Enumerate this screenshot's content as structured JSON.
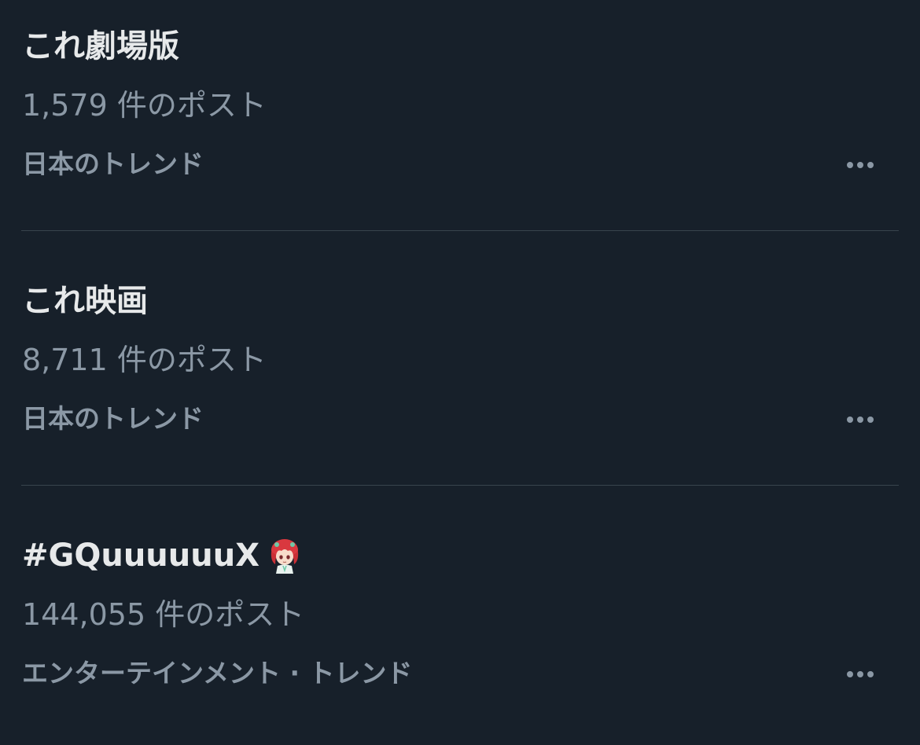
{
  "trends": [
    {
      "title": "これ劇場版",
      "count": "1,579 件のポスト",
      "context": "日本のトレンド",
      "more_icon": "more-horizontal-icon"
    },
    {
      "title": "これ映画",
      "count": "8,711 件のポスト",
      "context": "日本のトレンド",
      "more_icon": "more-horizontal-icon"
    },
    {
      "title": "#GQuuuuuuX",
      "title_emoji": "character-avatar-emoji",
      "count": "144,055 件のポスト",
      "context": "エンターテインメント · トレンド",
      "more_icon": "more-horizontal-icon"
    }
  ],
  "colors": {
    "background": "#17202a",
    "title_text": "#e7e9ea",
    "secondary_text": "#8b98a5",
    "divider": "#38444d"
  }
}
